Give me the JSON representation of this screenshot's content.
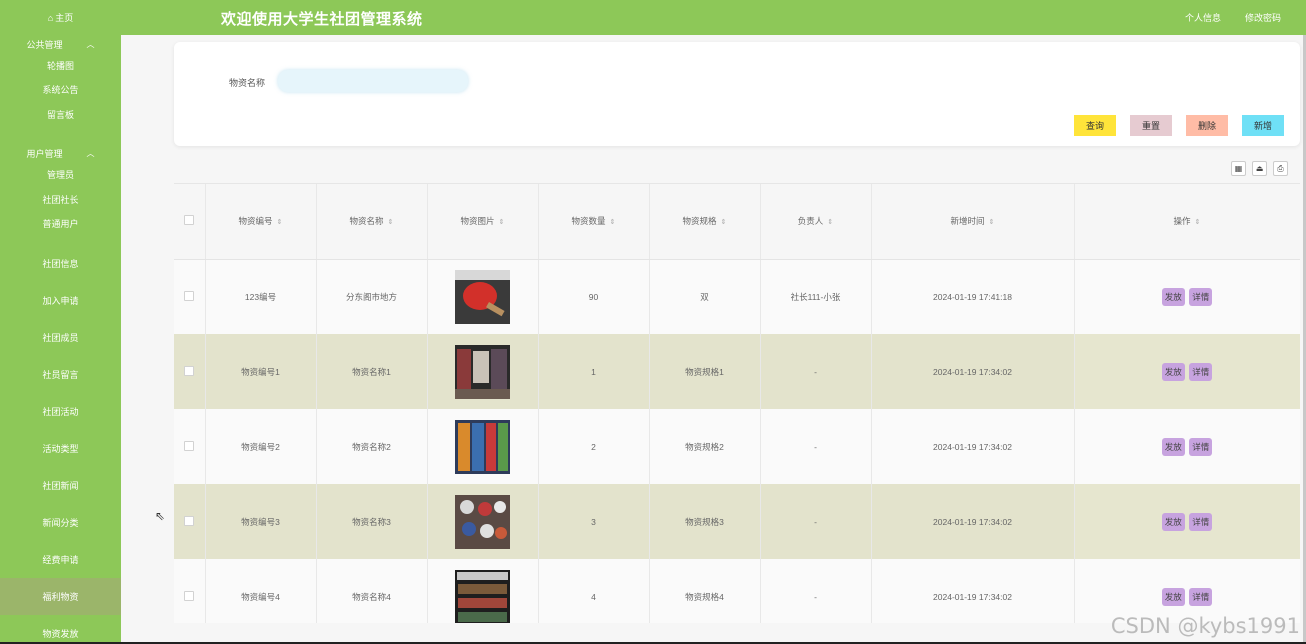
{
  "sidebar": {
    "home": "主页",
    "groups": [
      {
        "title": "公共管理",
        "items": [
          "轮播图",
          "系统公告",
          "留言板"
        ]
      },
      {
        "title": "用户管理",
        "items": [
          "管理员",
          "社团社长",
          "普通用户"
        ]
      }
    ],
    "items": [
      "社团信息",
      "加入申请",
      "社团成员",
      "社员留言",
      "社团活动",
      "活动类型",
      "社团新闻",
      "新闻分类",
      "经费申请",
      "福利物资",
      "物资发放"
    ],
    "active_index": 9
  },
  "topbar": {
    "title": "欢迎使用大学生社团管理系统",
    "profile": "个人信息",
    "change_password": "修改密码"
  },
  "search": {
    "label": "物资名称",
    "value": "",
    "buttons": {
      "query": "查询",
      "reset": "重置",
      "delete": "删除",
      "add": "新增"
    }
  },
  "table": {
    "columns": [
      "物资编号",
      "物资名称",
      "物资图片",
      "物资数量",
      "物资规格",
      "负责人",
      "新增时间",
      "操作"
    ],
    "rows": [
      {
        "code": "123编号",
        "name": "分东阁市地方",
        "qty": "90",
        "spec": "双",
        "owner": "社长111-小张",
        "time": "2024-01-19 17:41:18"
      },
      {
        "code": "物资编号1",
        "name": "物资名称1",
        "qty": "1",
        "spec": "物资规格1",
        "owner": "-",
        "time": "2024-01-19 17:34:02"
      },
      {
        "code": "物资编号2",
        "name": "物资名称2",
        "qty": "2",
        "spec": "物资规格2",
        "owner": "-",
        "time": "2024-01-19 17:34:02"
      },
      {
        "code": "物资编号3",
        "name": "物资名称3",
        "qty": "3",
        "spec": "物资规格3",
        "owner": "-",
        "time": "2024-01-19 17:34:02"
      },
      {
        "code": "物资编号4",
        "name": "物资名称4",
        "qty": "4",
        "spec": "物资规格4",
        "owner": "-",
        "time": "2024-01-19 17:34:02"
      }
    ],
    "actions": {
      "issue": "发放",
      "detail": "详情"
    }
  },
  "watermark": "CSDN @kybs1991",
  "colors": {
    "primary_green": "#8dc858",
    "query": "#ffe43a",
    "reset": "#e6cbd1",
    "delete": "#ffbca6",
    "add": "#6fe0f6",
    "action": "#c7a3df"
  }
}
